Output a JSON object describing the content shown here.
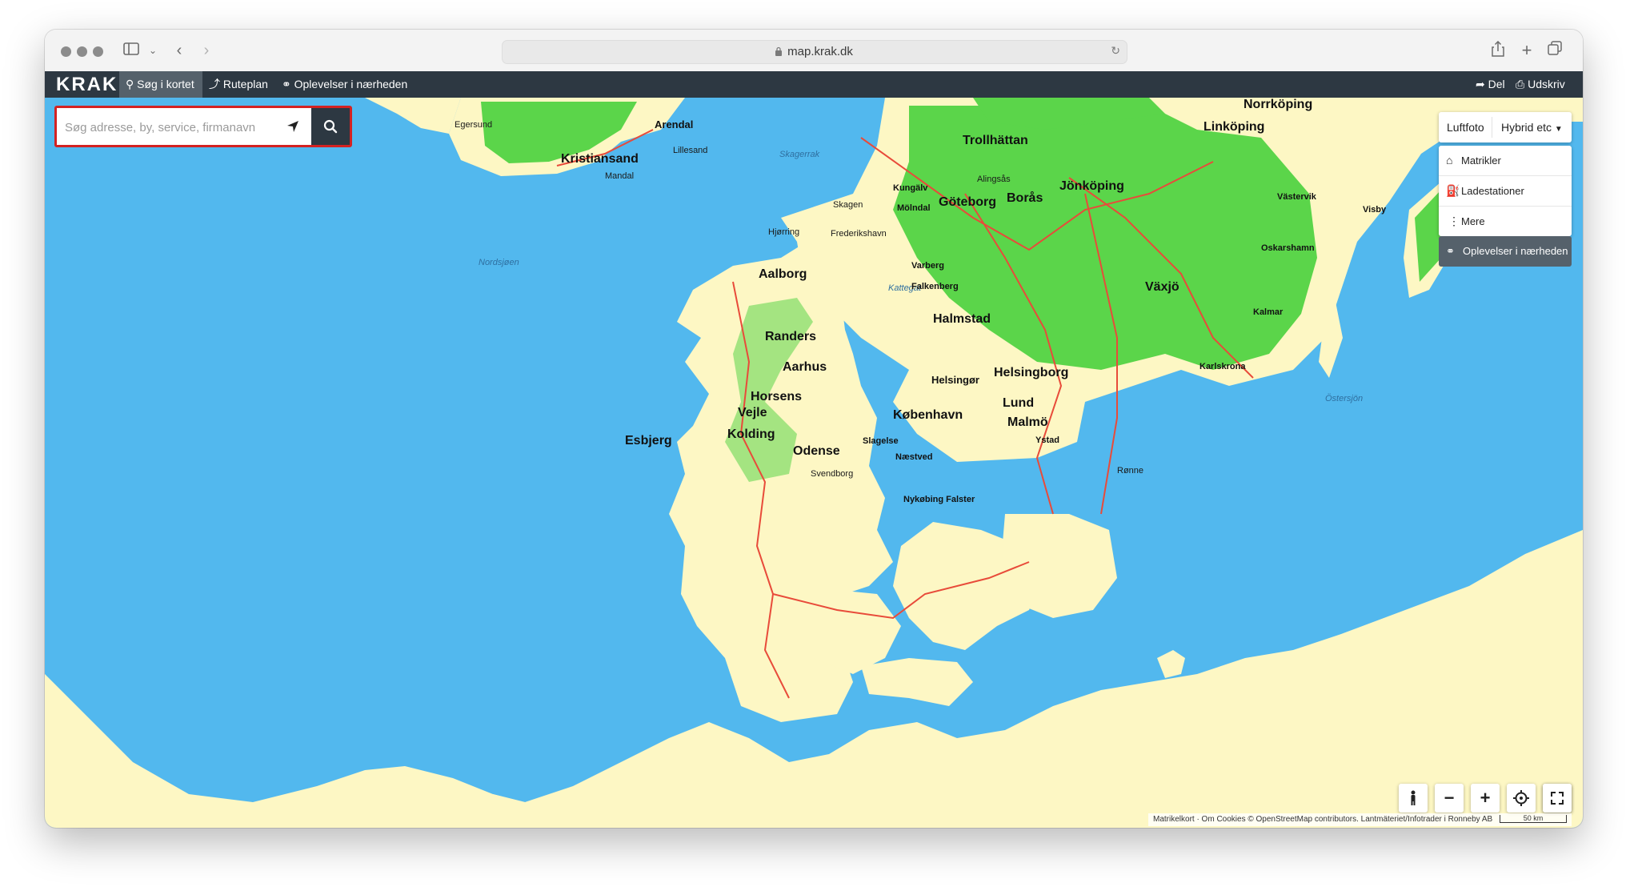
{
  "browser": {
    "url": "map.krak.dk"
  },
  "navbar": {
    "logo": "KRAK",
    "items": [
      {
        "label": "Søg i kortet"
      },
      {
        "label": "Ruteplan"
      },
      {
        "label": "Oplevelser i nærheden"
      }
    ],
    "share_label": "Del",
    "print_label": "Udskriv"
  },
  "search": {
    "placeholder": "Søg adresse, by, service, firmanavn"
  },
  "layers": {
    "aerial_label": "Luftfoto",
    "map_type_label": "Hybrid etc",
    "options": [
      {
        "label": "Matrikler",
        "icon": "cadastre-icon"
      },
      {
        "label": "Ladestationer",
        "icon": "charging-station-icon"
      },
      {
        "label": "Mere",
        "icon": "more-icon"
      }
    ],
    "experiences_label": "Oplevelser i nærheden"
  },
  "controls": {
    "zoom_out": "−",
    "zoom_in": "+"
  },
  "attribution": {
    "text": "Matrikelkort · Om Cookies  © OpenStreetMap contributors. Lantmäteriet/Infotrader i Ronneby AB",
    "scale": "50 km"
  },
  "colors": {
    "water": "#52b8ee",
    "land": "#fdf7c4",
    "forest": "#5bd54a",
    "navbar": "#2d3842",
    "highlight": "#d32222"
  },
  "map_labels": {
    "sea_nordsjoen": "Nordsjøen",
    "sea_skagerrak": "Skagerrak",
    "sea_kattegat": "Kattegat",
    "sea_ostersjon": "Östersjön",
    "kristiansand": "Kristiansand",
    "arendal": "Arendal",
    "lillesand": "Lillesand",
    "mandal": "Mandal",
    "egersund": "Egersund",
    "skagen": "Skagen",
    "hjorring": "Hjørring",
    "frederikshavn": "Frederikshavn",
    "aalborg": "Aalborg",
    "randers": "Randers",
    "aarhus": "Aarhus",
    "horsens": "Horsens",
    "vejle": "Vejle",
    "kolding": "Kolding",
    "esbjerg": "Esbjerg",
    "odense": "Odense",
    "svendborg": "Svendborg",
    "koebenhavn": "København",
    "helsingor": "Helsingør",
    "nykobing": "Nykøbing Falster",
    "naestved": "Næstved",
    "slagelse": "Slagelse",
    "trollhattan": "Trollhättan",
    "goteborg": "Göteborg",
    "boras": "Borås",
    "jonkoping": "Jönköping",
    "norrkoping": "Norrköping",
    "linkoping": "Linköping",
    "halmstad": "Halmstad",
    "helsingborg": "Helsingborg",
    "lund": "Lund",
    "malmo": "Malmö",
    "vaxjo": "Växjö",
    "kalmar": "Kalmar",
    "karlskrona": "Karlskrona",
    "visby": "Visby",
    "ystad": "Ystad",
    "ronne": "Rønne",
    "varberg": "Varberg",
    "falkenberg": "Falkenberg",
    "kungalv": "Kungälv",
    "molndal": "Mölndal",
    "alingsas": "Alingsås",
    "oskarshamn": "Oskarshamn",
    "vastervik": "Västervik"
  }
}
